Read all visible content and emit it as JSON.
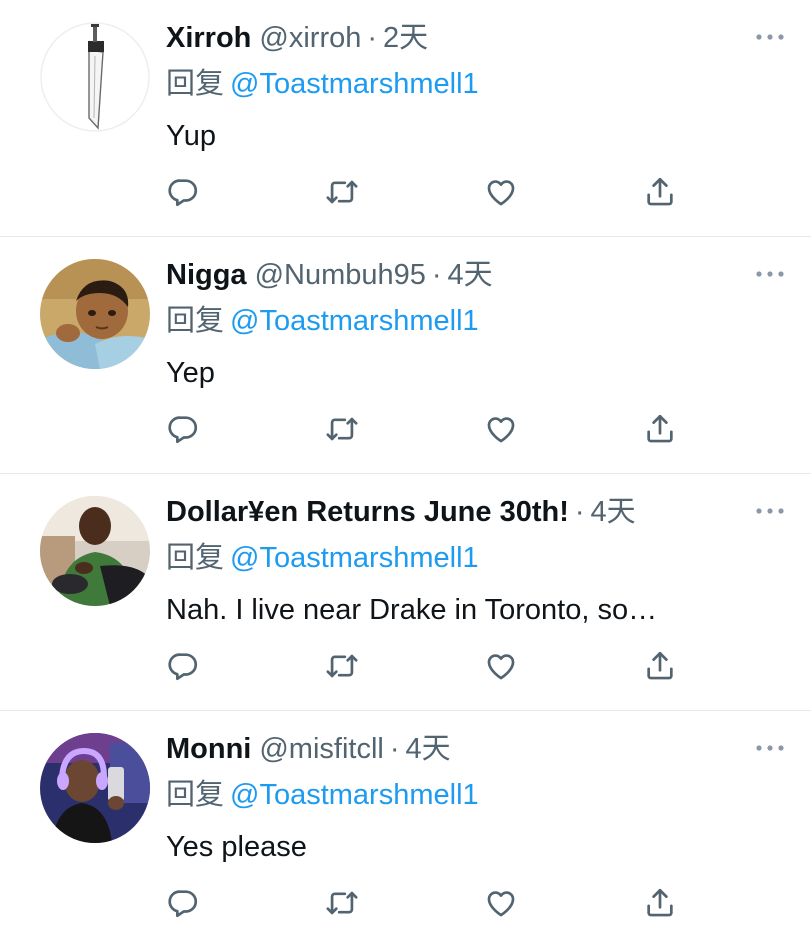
{
  "tweets": [
    {
      "name": "Xirroh",
      "handle": "@xirroh",
      "separator": "·",
      "time": "2天",
      "reply_prefix": "回复",
      "reply_to": "@Toastmarshmell1",
      "text": "Yup",
      "avatar": "sword-avatar"
    },
    {
      "name": "Nigga",
      "handle": "@Numbuh95",
      "separator": "·",
      "time": "4天",
      "reply_prefix": "回复",
      "reply_to": "@Toastmarshmell1",
      "text": "Yep",
      "avatar": "cartoon-boy-avatar"
    },
    {
      "name": "Dollar¥en Returns June 30th!",
      "handle": "",
      "separator": "·",
      "time": "4天",
      "reply_prefix": "回复",
      "reply_to": "@Toastmarshmell1",
      "text": "Nah. I live near Drake in Toronto, so…",
      "avatar": "man-photo-avatar"
    },
    {
      "name": "Monni",
      "handle": "@misfitcll",
      "separator": "·",
      "time": "4天",
      "reply_prefix": "回复",
      "reply_to": "@Toastmarshmell1",
      "text": "Yes please",
      "avatar": "woman-headphones-avatar"
    }
  ],
  "icons": {
    "more": "more-horizontal-icon",
    "reply": "reply-icon",
    "retweet": "retweet-icon",
    "like": "like-icon",
    "share": "share-icon"
  },
  "colors": {
    "text": "#0f1419",
    "secondary": "#536471",
    "link": "#1d9bf0",
    "divider": "#e6e9eb"
  }
}
